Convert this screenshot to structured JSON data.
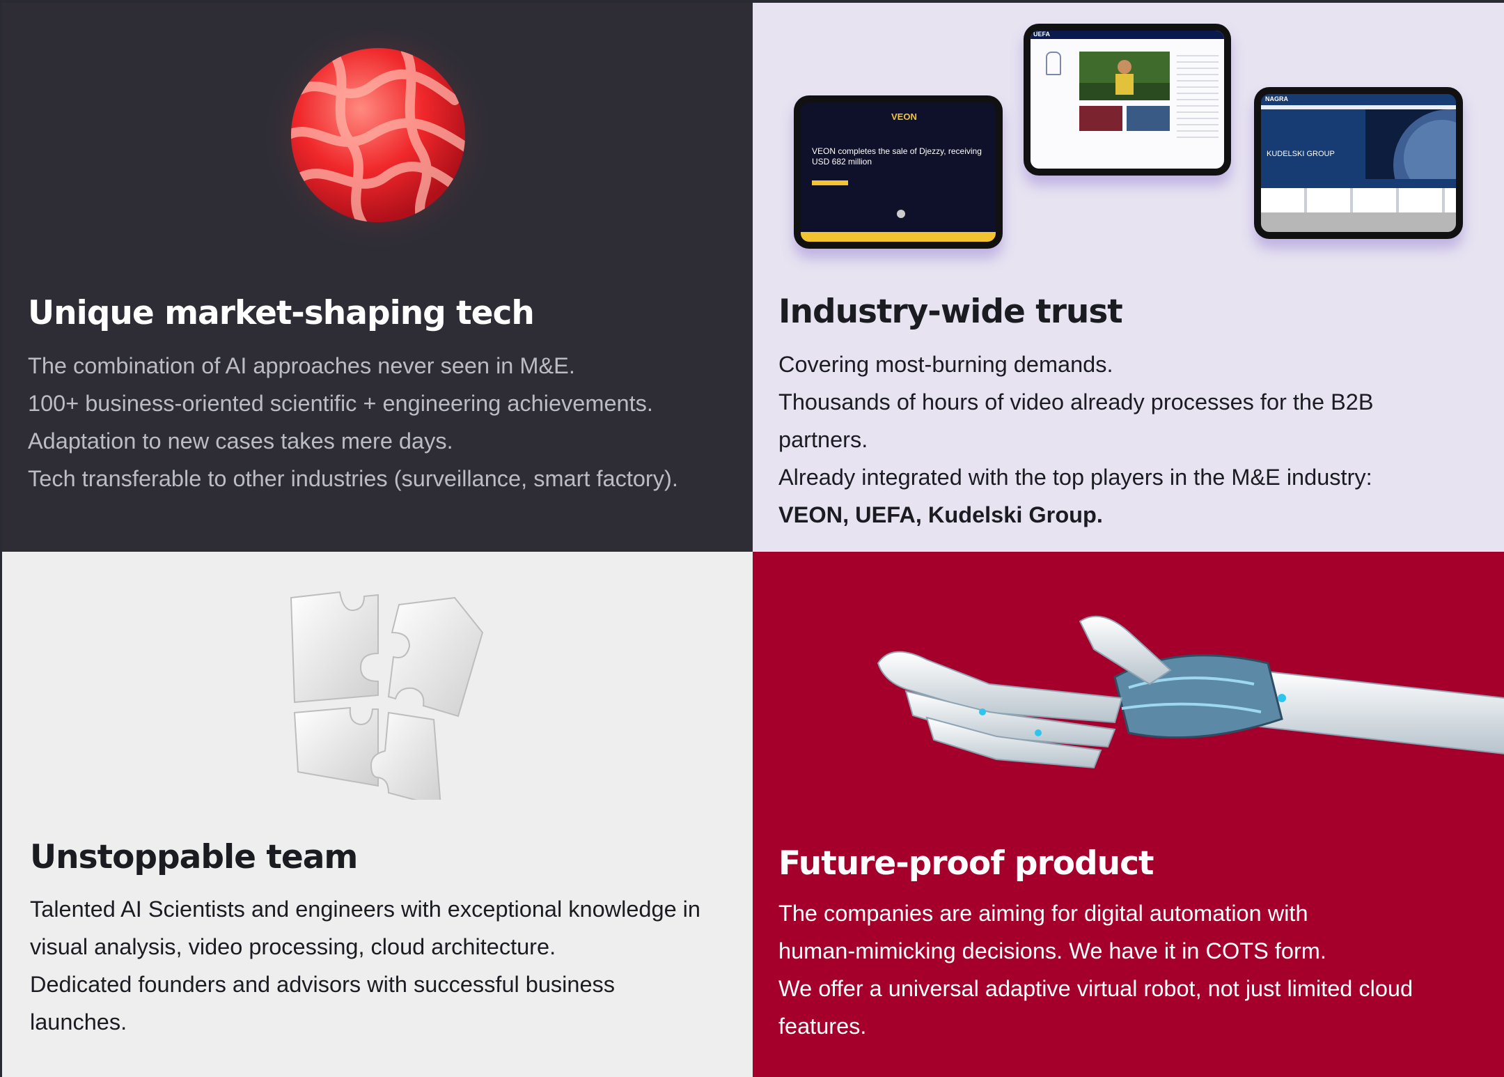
{
  "colors": {
    "page_border": "#2a2a33",
    "tile_dark": "#2e2d36",
    "tile_lavender": "#e7e3f1",
    "tile_light": "#eeeeee",
    "tile_red": "#a5002b",
    "sphere_red": "#ff3b3b"
  },
  "tiles": {
    "tech": {
      "title": "Unique market-shaping tech",
      "lines": [
        "The combination of AI approaches never seen in M&E.",
        "100+ business-oriented scientific + engineering achievements.",
        "Adaptation to new cases takes mere days.",
        "Tech transferable to other industries (surveillance, smart factory)."
      ],
      "icon": "red-sphere"
    },
    "trust": {
      "title": "Industry-wide trust",
      "lines": [
        "Covering most-burning demands.",
        "Thousands of hours of video already processes for the B2B",
        "partners.",
        "Already integrated with the top players in the M&E industry:"
      ],
      "partners": "VEON, UEFA, Kudelski Group.",
      "tablets": {
        "veon": {
          "brand": "VEON",
          "headline_1": "VEON completes the sale of Djezzy, receiving",
          "headline_2": "USD 682 million"
        },
        "uefa": {
          "brand": "UEFA"
        },
        "kudelski": {
          "brand": "NAGRA",
          "headline": "KUDELSKI GROUP"
        }
      }
    },
    "team": {
      "title": "Unstoppable team",
      "lines": [
        "Talented AI Scientists and engineers with exceptional knowledge in",
        "visual analysis, video processing, cloud architecture.",
        "Dedicated founders and advisors with successful business",
        "launches."
      ],
      "icon": "puzzle"
    },
    "product": {
      "title": "Future-proof product",
      "lines": [
        "The companies are aiming for digital automation with",
        "human-mimicking decisions. We have it in COTS form.",
        "We offer a universal adaptive virtual robot, not just limited cloud",
        "features."
      ],
      "icon": "robot-hand"
    }
  }
}
